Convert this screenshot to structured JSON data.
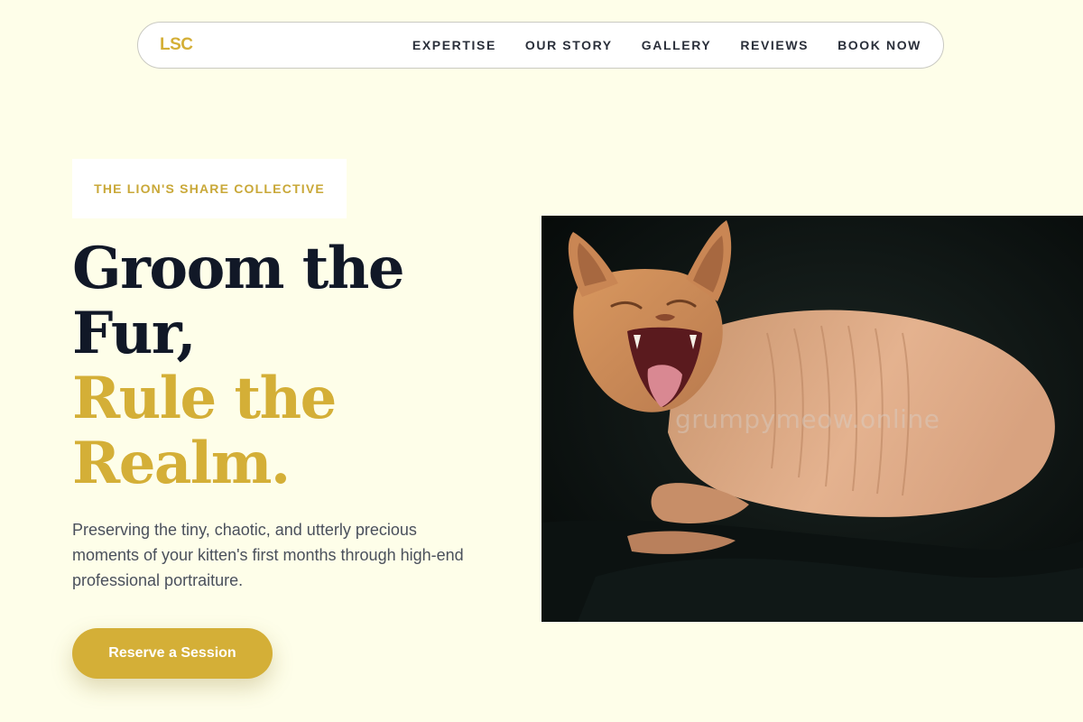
{
  "nav": {
    "logo": "LSC",
    "links": [
      "EXPERTISE",
      "OUR STORY",
      "GALLERY",
      "REVIEWS",
      "BOOK NOW"
    ]
  },
  "hero": {
    "eyebrow": "THE LION'S SHARE COLLECTIVE",
    "headline_dark_1": "Groom the",
    "headline_dark_2": "Fur,",
    "headline_gold_1": "Rule the",
    "headline_gold_2": "Realm.",
    "subtext": "Preserving the tiny, chaotic, and utterly precious moments of your kitten's first months through high-end professional portraiture.",
    "cta_label": "Reserve a Session",
    "image_watermark": "grumpymeow.online"
  },
  "colors": {
    "background": "#fefee9",
    "accent_gold": "#d4af37",
    "text_dark": "#111827",
    "text_body": "#4a505c"
  }
}
